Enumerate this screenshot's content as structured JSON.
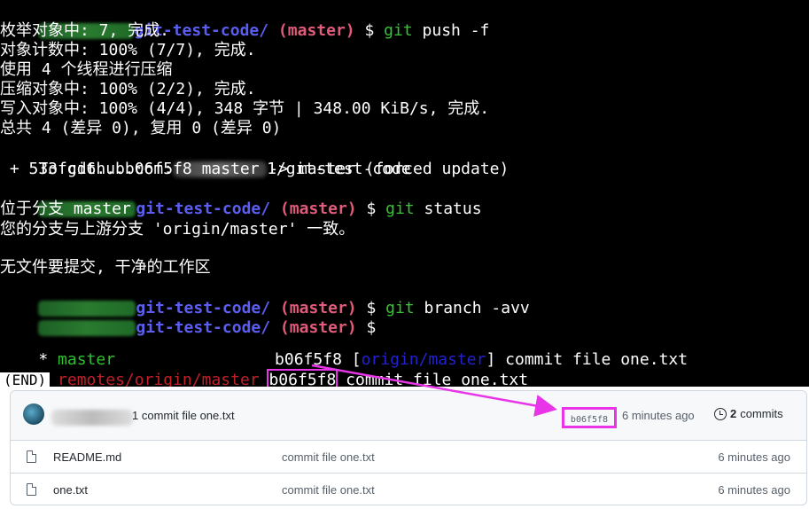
{
  "terminal": {
    "prompt_path": "git-test-code/",
    "prompt_branch": "master",
    "prompt_symbol": "$",
    "cmd1_git": "git",
    "cmd1_rest": "push -f",
    "push_lines": [
      "枚举对象中: 7, 完成.",
      "对象计数中: 100% (7/7), 完成.",
      "使用 4 个线程进行压缩",
      "压缩对象中: 100% (2/2), 完成.",
      "写入对象中: 100% (4/4), 348 字节 | 348.00 KiB/s, 完成.",
      "总共 4 (差异 0), 复用 0 (差异 0)"
    ],
    "to_prefix": "To github.com:",
    "to_suffix": "1/git-test-code",
    "update_line": " + 533fcd6...b06f5f8 master -> master (forced update)",
    "cmd2_rest": "status",
    "status_lines": [
      "位于分支 master",
      "您的分支与上游分支 'origin/master' 一致。",
      "",
      "无文件要提交, 干净的工作区"
    ],
    "cmd3_rest": "branch -avv",
    "branch_star": "*",
    "branch1_name": "master",
    "branch1_sha": "b06f5f8",
    "branch1_upstream": "origin/master",
    "branch1_msg": "commit file one.txt",
    "branch2_name": "remotes/origin/master",
    "branch2_sha": "b06f5f8",
    "branch2_msg": "commit file one.txt",
    "end_marker": "(END)"
  },
  "github": {
    "latest_commit_msg": "1 commit file one.txt",
    "latest_commit_sha": "b06f5f8",
    "latest_commit_time": "6 minutes ago",
    "commits_count": "2",
    "commits_label": "commits",
    "files": [
      {
        "name": "README.md",
        "message": "commit file one.txt",
        "age": "6 minutes ago"
      },
      {
        "name": "one.txt",
        "message": "commit file one.txt",
        "age": "6 minutes ago"
      }
    ]
  },
  "colors": {
    "highlight": "#e835e8",
    "prompt_path": "#5b5ef0",
    "prompt_branch": "#e25b7a",
    "git_cmd": "#38c438"
  }
}
